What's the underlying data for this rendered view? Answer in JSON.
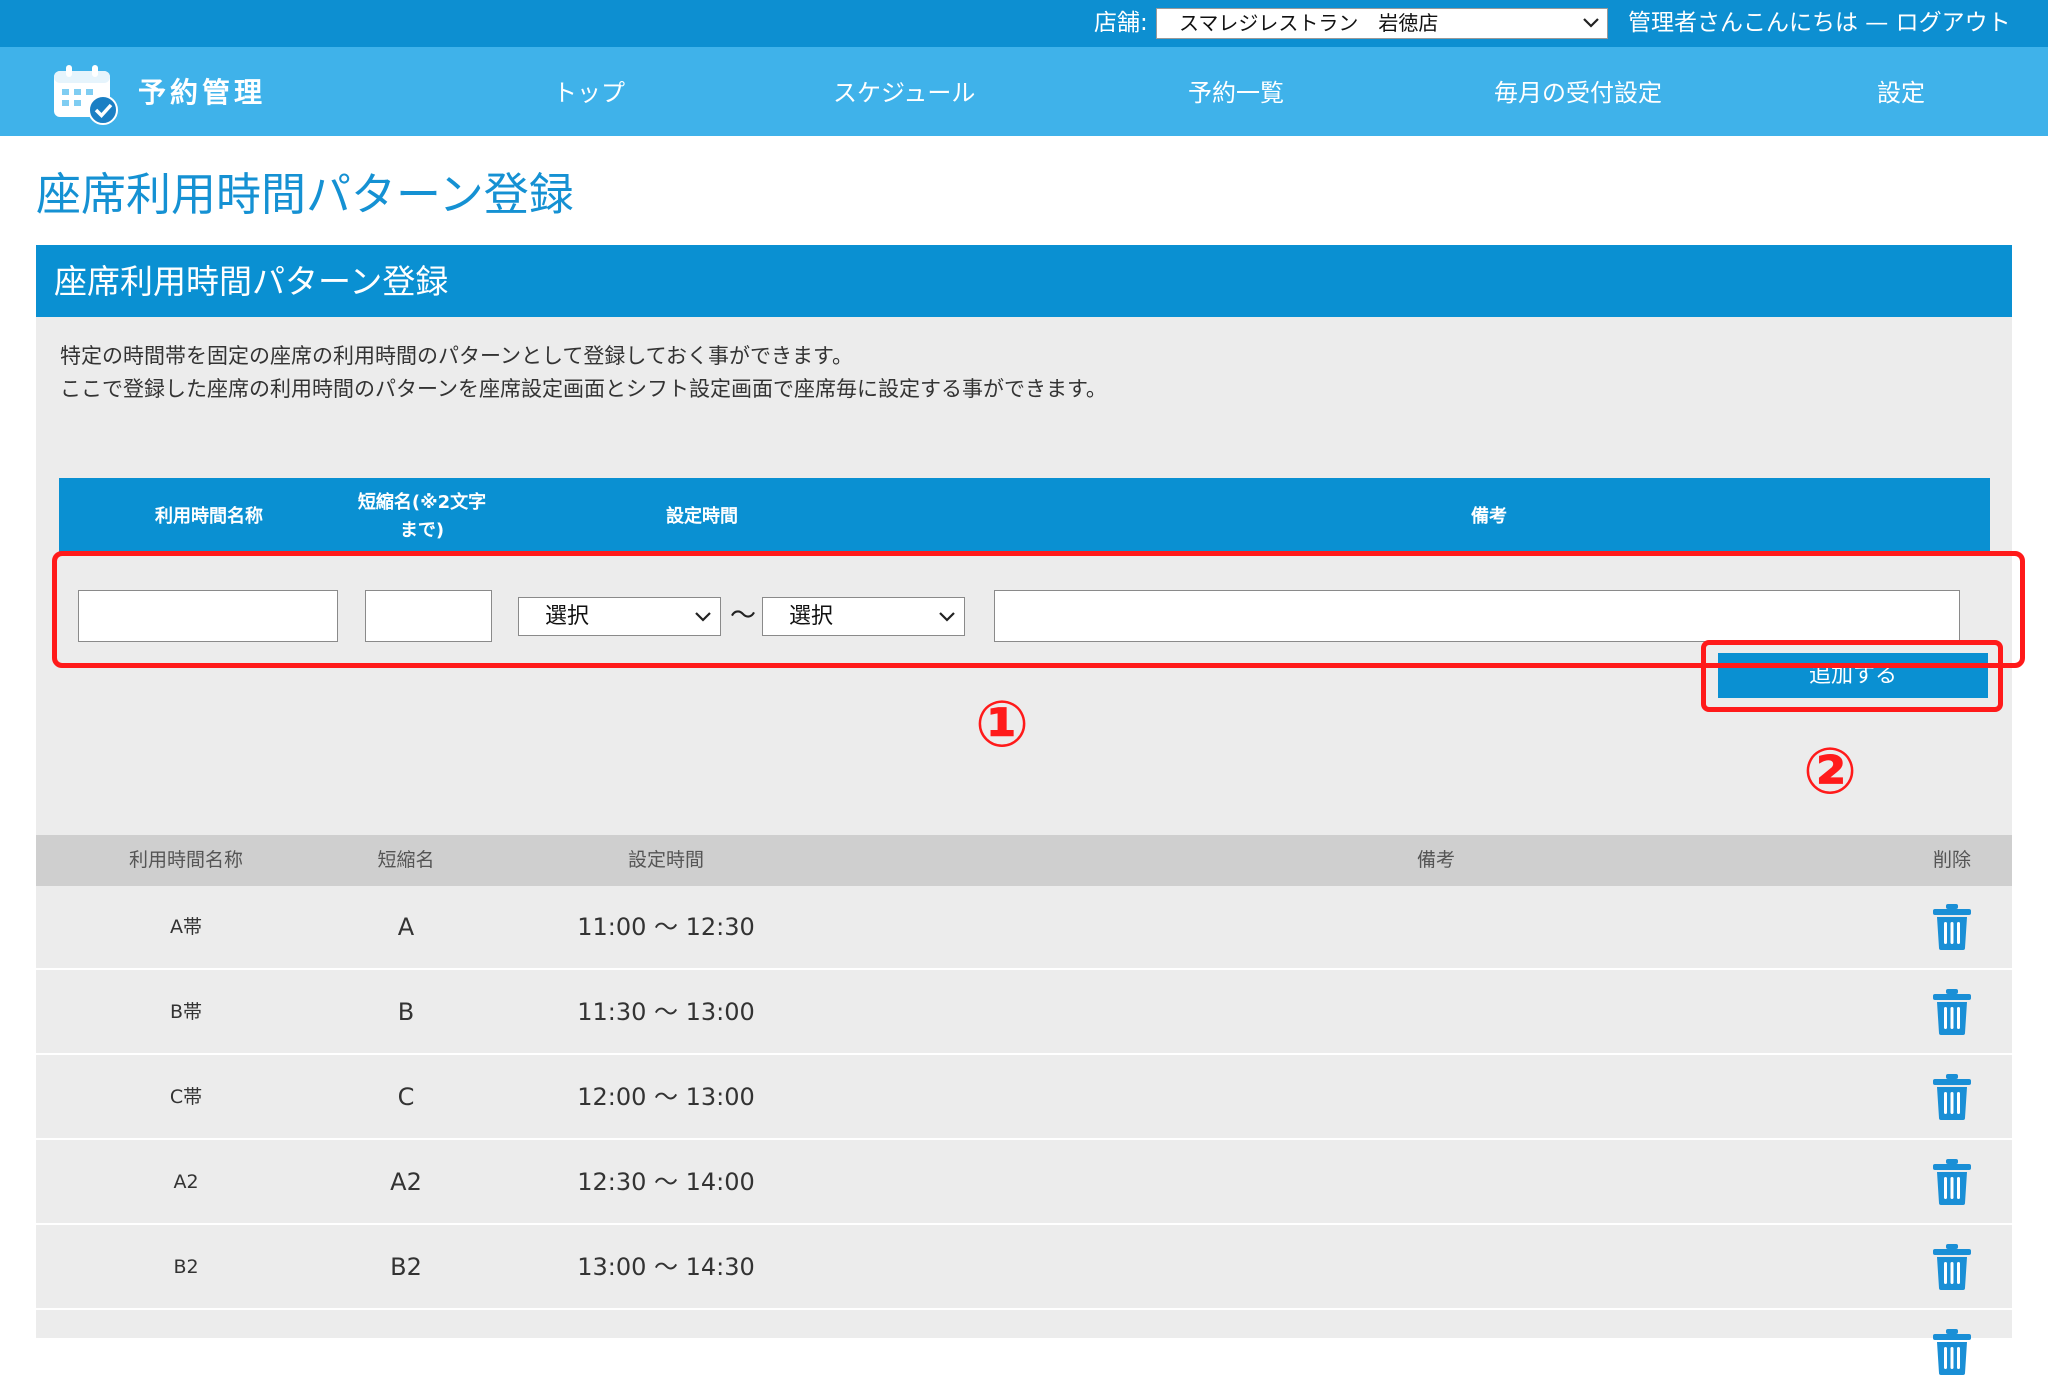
{
  "topbar": {
    "store_label": "店舗:",
    "store_selected": "スマレジレストラン　岩徳店",
    "greeting": "管理者さんこんにちは — ログアウト"
  },
  "nav": {
    "logo": "予約管理",
    "items": [
      {
        "label": "トップ"
      },
      {
        "label": "スケジュール"
      },
      {
        "label": "予約一覧"
      },
      {
        "label": "毎月の受付設定"
      },
      {
        "label": "設定"
      }
    ]
  },
  "page_title": "座席利用時間パターン登録",
  "panel": {
    "title": "座席利用時間パターン登録",
    "description": [
      "特定の時間帯を固定の座席の利用時間のパターンとして登録しておく事ができます。",
      "ここで登録した座席の利用時間のパターンを座席設定画面とシフト設定画面で座席毎に設定する事ができます。"
    ]
  },
  "form": {
    "headers": {
      "name": "利用時間名称",
      "short": "短縮名(※2文字まで)",
      "time": "設定時間",
      "note": "備考"
    },
    "name_value": "",
    "short_value": "",
    "start_select": "選択",
    "tilde": "〜",
    "end_select": "選択",
    "note_value": "",
    "add_button": "追加する"
  },
  "annotations": {
    "marker1": "①",
    "marker2": "②",
    "color": "#ff1a1a"
  },
  "list": {
    "headers": {
      "name": "利用時間名称",
      "short": "短縮名",
      "time": "設定時間",
      "note": "備考",
      "delete": "削除"
    },
    "rows": [
      {
        "name": "A帯",
        "short": "A",
        "time": "11:00 〜 12:30",
        "note": ""
      },
      {
        "name": "B帯",
        "short": "B",
        "time": "11:30 〜 13:00",
        "note": ""
      },
      {
        "name": "C帯",
        "short": "C",
        "time": "12:00 〜 13:00",
        "note": ""
      },
      {
        "name": "A2",
        "short": "A2",
        "time": "12:30 〜 14:00",
        "note": ""
      },
      {
        "name": "B2",
        "short": "B2",
        "time": "13:00 〜 14:30",
        "note": ""
      }
    ]
  },
  "colors": {
    "topbar": "#0d8fd1",
    "navbar": "#3fb2ea",
    "accent": "#0a90d2",
    "panel_bg": "#ececec",
    "list_header": "#cfcfcf",
    "trash_icon": "#1a8fd6"
  }
}
